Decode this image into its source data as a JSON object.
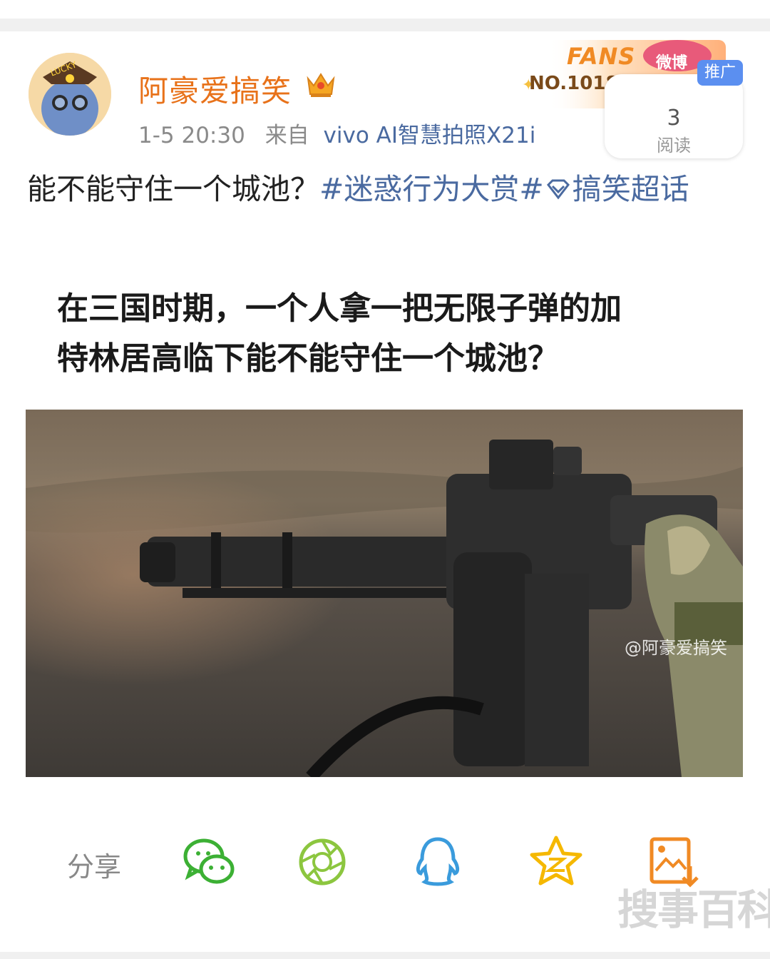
{
  "post": {
    "username": "阿豪爱搞笑",
    "time": "1-5 20:30",
    "from_label": "来自",
    "source": "vivo AI智慧拍照X21i",
    "fans_badge": {
      "label": "FANS",
      "number": "NO.1018",
      "tag": "微博"
    },
    "promo": "推广",
    "reads": {
      "count": "3",
      "label": "阅读"
    },
    "text": "能不能守住一个城池？",
    "hashtag": "#迷惑行为大赏#",
    "topic": "搞笑超话",
    "image": {
      "caption_line1": "在三国时期，一个人拿一把无限子弹的加",
      "caption_line2": "特林居高临下能不能守住一个城池？",
      "watermark": "@阿豪爱搞笑"
    }
  },
  "share": {
    "label": "分享",
    "icons": [
      "wechat-icon",
      "moments-icon",
      "qq-icon",
      "qzone-icon",
      "save-image-icon"
    ]
  },
  "corner_watermark": "搜事百科",
  "colors": {
    "username": "#e8721a",
    "link": "#4a6aa0",
    "wechat": "#3cb034",
    "moments": "#8cc63f",
    "qq": "#3a9bdc",
    "qzone": "#f5b800",
    "save": "#f08a24"
  }
}
